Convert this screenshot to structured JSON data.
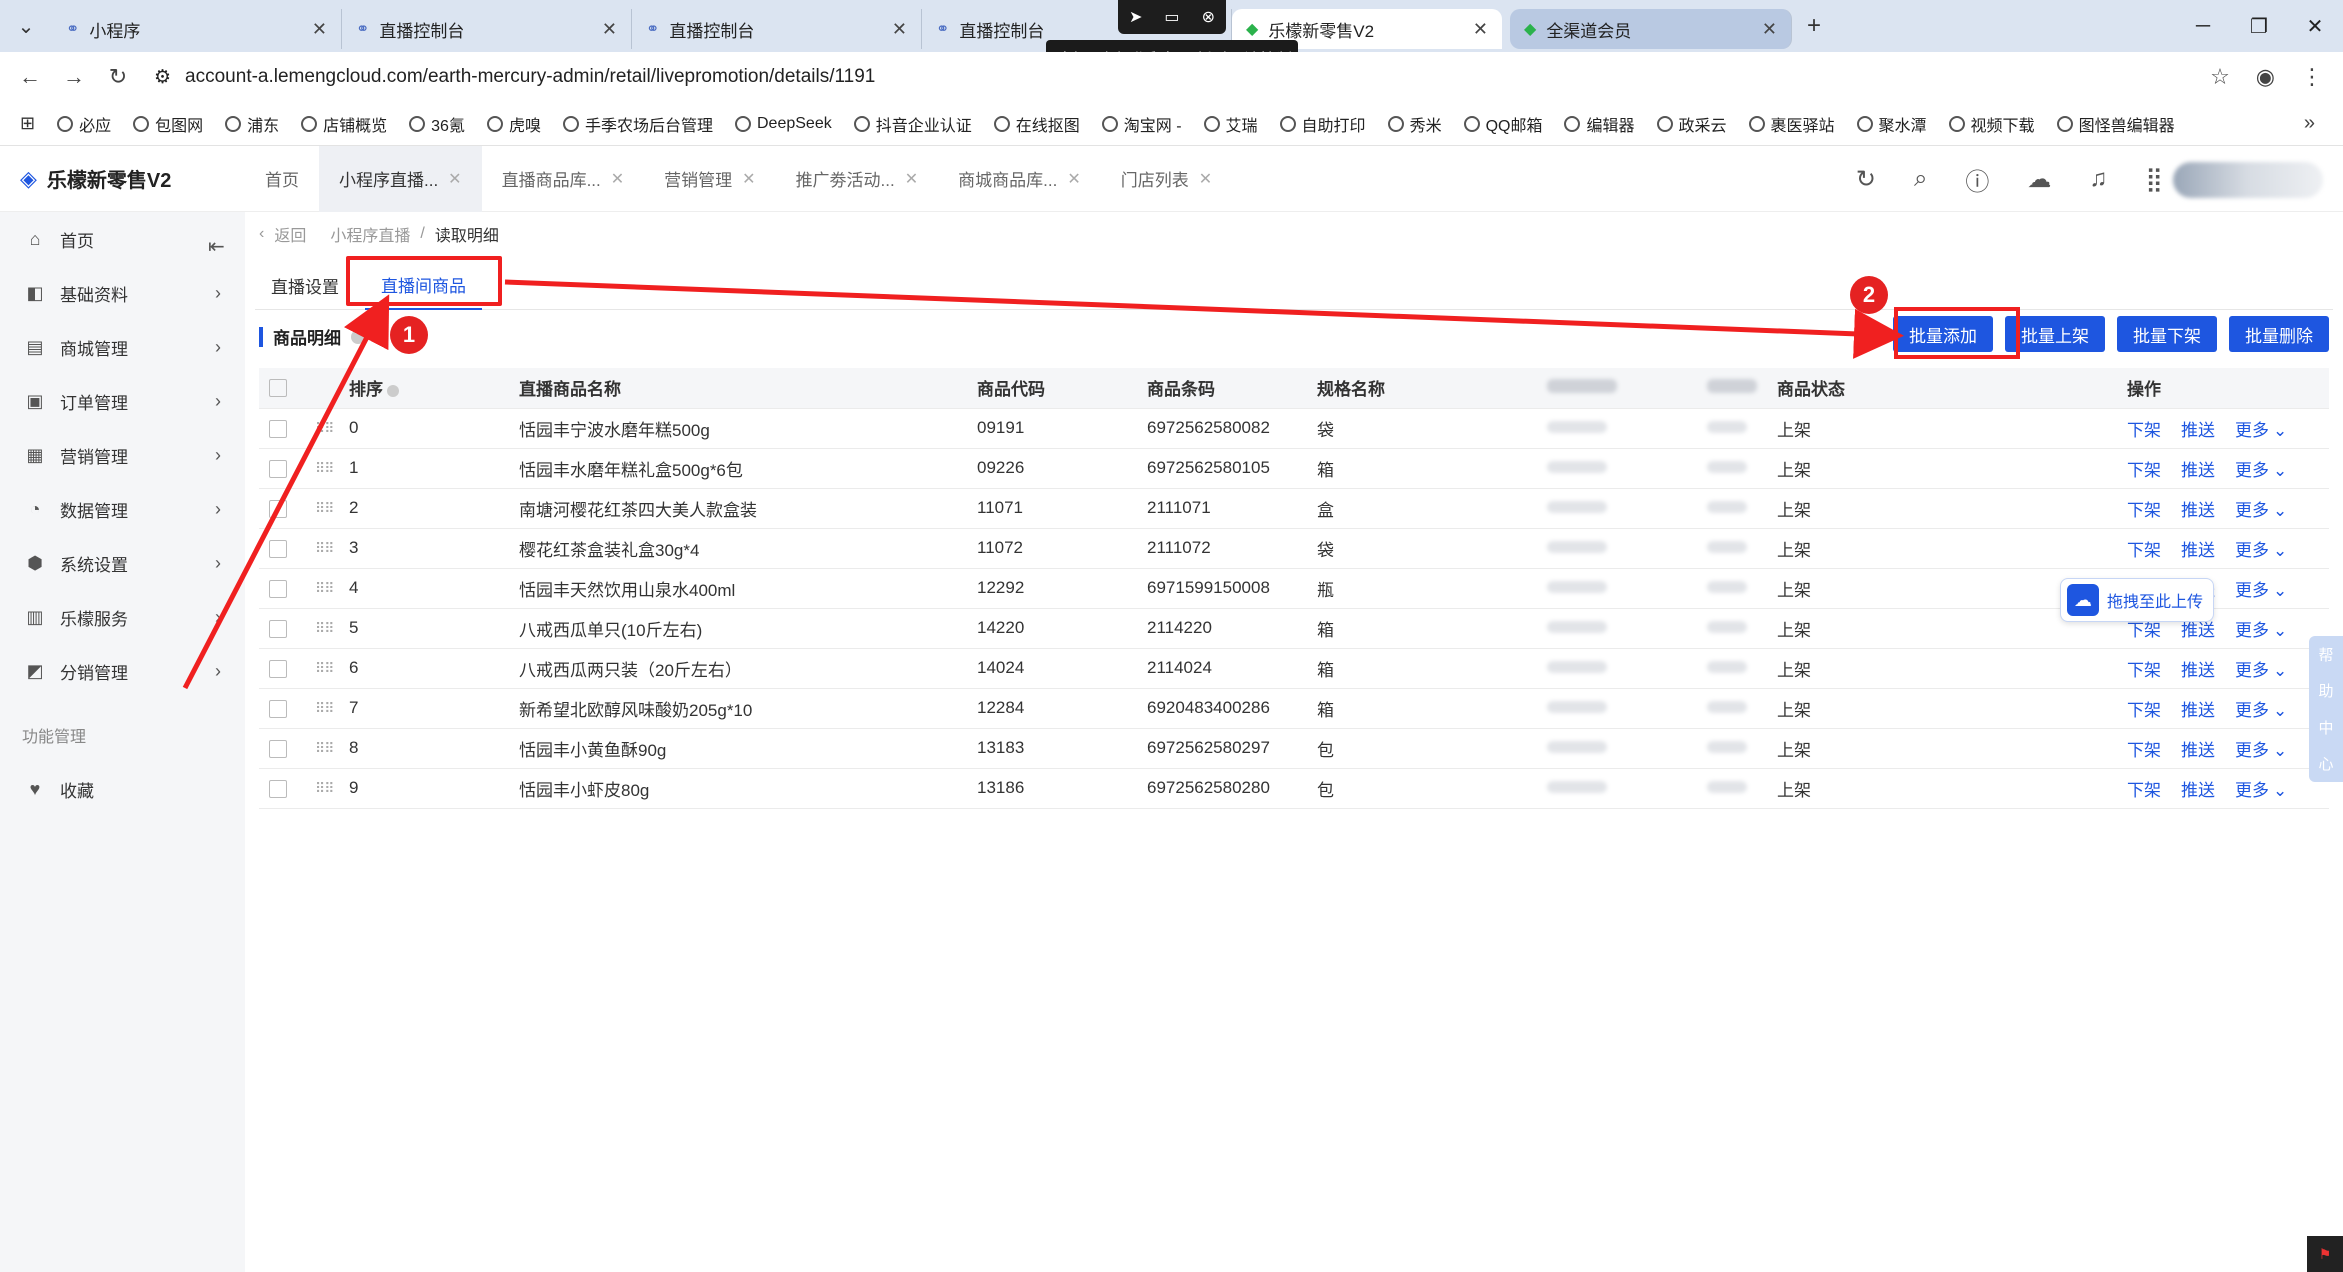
{
  "browser": {
    "tabs": [
      {
        "label": "小程序",
        "state": "normal"
      },
      {
        "label": "直播控制台",
        "state": "normal"
      },
      {
        "label": "直播控制台",
        "state": "normal"
      },
      {
        "label": "直播控制台",
        "state": "normal"
      },
      {
        "label": "乐檬新零售V2",
        "state": "active"
      },
      {
        "label": "全渠道会员",
        "state": "highlight"
      }
    ],
    "remote_tip": "对方正在操作鼠标，暂时无法控制",
    "url": "account-a.lemengcloud.com/earth-mercury-admin/retail/livepromotion/details/1191",
    "bookmarks": [
      "必应",
      "包图网",
      "浦东",
      "店铺概览",
      "36氪",
      "虎嗅",
      "手季农场后台管理",
      "DeepSeek",
      "抖音企业认证",
      "在线抠图",
      "淘宝网 -",
      "艾瑞",
      "自助打印",
      "秀米",
      "QQ邮箱",
      "编辑器",
      "政采云",
      "裹医驿站",
      "聚水潭",
      "视频下载",
      "图怪兽编辑器"
    ]
  },
  "app": {
    "logo": "乐檬新零售V2",
    "page_tabs": [
      {
        "label": "首页",
        "closable": false,
        "active": false
      },
      {
        "label": "小程序直播...",
        "closable": true,
        "active": true
      },
      {
        "label": "直播商品库...",
        "closable": true,
        "active": false
      },
      {
        "label": "营销管理",
        "closable": true,
        "active": false
      },
      {
        "label": "推广劵活动...",
        "closable": true,
        "active": false
      },
      {
        "label": "商城商品库...",
        "closable": true,
        "active": false
      },
      {
        "label": "门店列表",
        "closable": true,
        "active": false
      }
    ]
  },
  "sidebar": {
    "items": [
      {
        "label": "首页",
        "icon": "home-icon"
      },
      {
        "label": "基础资料",
        "icon": "cube-icon"
      },
      {
        "label": "商城管理",
        "icon": "store-icon"
      },
      {
        "label": "订单管理",
        "icon": "order-icon"
      },
      {
        "label": "营销管理",
        "icon": "chart-icon"
      },
      {
        "label": "数据管理",
        "icon": "pie-icon"
      },
      {
        "label": "系统设置",
        "icon": "settings-icon"
      },
      {
        "label": "乐檬服务",
        "icon": "service-icon"
      },
      {
        "label": "分销管理",
        "icon": "distribution-icon"
      }
    ],
    "group_label": "功能管理",
    "favorites": "收藏"
  },
  "main": {
    "breadcrumb": {
      "back": "返回",
      "parent": "小程序直播",
      "current": "读取明细"
    },
    "subtabs": [
      "直播设置",
      "直播间商品"
    ],
    "section_title": "商品明细",
    "actions": [
      "批量添加",
      "批量上架",
      "批量下架",
      "批量删除"
    ],
    "table": {
      "headers": [
        "排序",
        "直播商品名称",
        "商品代码",
        "商品条码",
        "规格名称",
        "商品状态",
        "操作"
      ],
      "rows": [
        {
          "order": "0",
          "name": "恬园丰宁波水磨年糕500g",
          "code": "09191",
          "barcode": "6972562580082",
          "spec": "袋",
          "status": "上架"
        },
        {
          "order": "1",
          "name": "恬园丰水磨年糕礼盒500g*6包",
          "code": "09226",
          "barcode": "6972562580105",
          "spec": "箱",
          "status": "上架"
        },
        {
          "order": "2",
          "name": "南塘河樱花红茶四大美人款盒装",
          "code": "11071",
          "barcode": "2111071",
          "spec": "盒",
          "status": "上架"
        },
        {
          "order": "3",
          "name": "樱花红茶盒装礼盒30g*4",
          "code": "11072",
          "barcode": "2111072",
          "spec": "袋",
          "status": "上架"
        },
        {
          "order": "4",
          "name": "恬园丰天然饮用山泉水400ml",
          "code": "12292",
          "barcode": "6971599150008",
          "spec": "瓶",
          "status": "上架"
        },
        {
          "order": "5",
          "name": "八戒西瓜单只(10斤左右)",
          "code": "14220",
          "barcode": "2114220",
          "spec": "箱",
          "status": "上架"
        },
        {
          "order": "6",
          "name": "八戒西瓜两只装（20斤左右）",
          "code": "14024",
          "barcode": "2114024",
          "spec": "箱",
          "status": "上架"
        },
        {
          "order": "7",
          "name": "新希望北欧醇风味酸奶205g*10",
          "code": "12284",
          "barcode": "6920483400286",
          "spec": "箱",
          "status": "上架"
        },
        {
          "order": "8",
          "name": "恬园丰小黄鱼酥90g",
          "code": "13183",
          "barcode": "6972562580297",
          "spec": "包",
          "status": "上架"
        },
        {
          "order": "9",
          "name": "恬园丰小虾皮80g",
          "code": "13186",
          "barcode": "6972562580280",
          "spec": "包",
          "status": "上架"
        }
      ],
      "row_actions": [
        "下架",
        "推送",
        "更多"
      ]
    }
  },
  "annotations": {
    "marker1": "1",
    "marker2": "2",
    "color": "#e52222"
  },
  "upload_float": "拖拽至此上传",
  "help_side": [
    "帮",
    "助",
    "中",
    "心"
  ],
  "colors": {
    "accent": "#1e56e0",
    "status": "#e9a400",
    "annotation": "#f02020"
  }
}
